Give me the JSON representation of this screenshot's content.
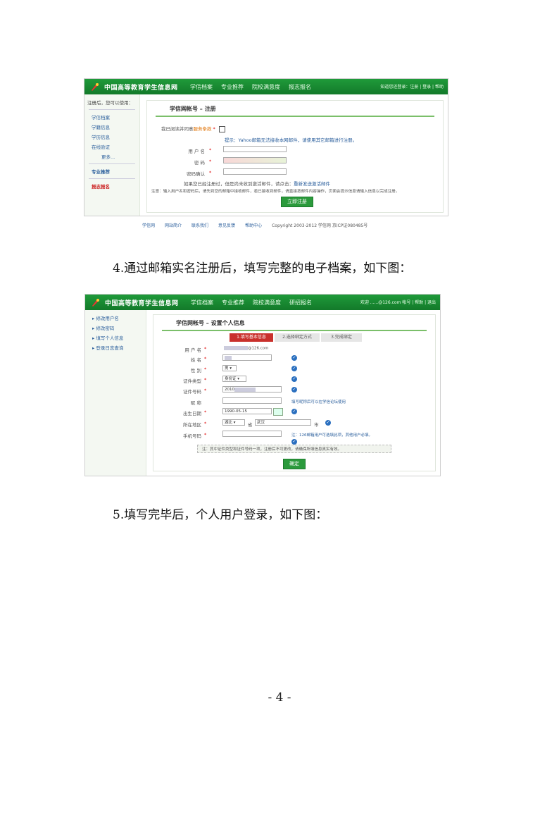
{
  "screenshot1": {
    "brand": "中国高等教育学生信息网",
    "nav": [
      "学信档案",
      "专业推荐",
      "院校满意度",
      "报志报名"
    ],
    "header_links": "知道您还登录：注册 | 登录 | 帮助",
    "side_header": "注册后，您可以使用：",
    "side_items": [
      "学信档案",
      "学籍信息",
      "学历信息",
      "在线验证",
      "更多..."
    ],
    "side_recommend": "专业推荐",
    "side_enroll": "报志报名",
    "panel_title": "学信网帐号 – 注册",
    "field_agree": "我已阅读并同意",
    "agree_link": "服务条款",
    "hint": "提示：Yahoo邮箱无法接收本网邮件，请使用其它邮箱进行注册。",
    "field_username": "用 户 名",
    "field_password": "密    码",
    "field_confirm": "密码确认",
    "note1": "如果您已经注册过，但是尚未收到激活邮件，请点击：",
    "note1_link": "重新发送激活邮件",
    "note2": "注意：输入用户名和密码后，请先到您的邮箱中接收邮件，若已接收到邮件，请直接按邮件内容操作，页面会提示信息请输入信息以完成注册。",
    "submit": "立即注册",
    "footer": [
      "学信网",
      "网站简介",
      "联系我们",
      "意见反馈",
      "帮助中心"
    ],
    "copyright": "Copyright 2003-2012 学信网 京ICP证080485号"
  },
  "caption4": "4.通过邮箱实名注册后，填写完整的电子档案，如下图：",
  "screenshot2": {
    "brand": "中国高等教育学生信息网",
    "nav": [
      "学信档案",
      "专业推荐",
      "院校满意度",
      "研招报名"
    ],
    "header_links": "欢迎 ......@126.com 帐号 | 帮助 | 退出",
    "side_items": [
      "修改用户名",
      "修改密码",
      "填写个人信息",
      "登录日志查询"
    ],
    "panel_title": "学信网帐号 – 设置个人信息",
    "steps": [
      "1.填写基本信息",
      "2.选择绑定方式",
      "3.完成绑定"
    ],
    "field_username": "用 户 名",
    "username_value": "@126.com",
    "field_name": "姓    名",
    "field_gender": "性    别",
    "gender_value": "男",
    "field_id_type": "证件类型",
    "id_type_value": "身份证",
    "field_id_no": "证件号码",
    "id_no_value": "2010",
    "field_nickname": "昵    称",
    "nickname_hint": "填写昵称后可以在学信论坛使用",
    "field_birth": "出生日期",
    "birth_value": "1990-05-15",
    "field_location": "所在地区",
    "province_value": "湖北",
    "city_label": "省",
    "city_value": "武汉",
    "city_suffix": "市",
    "field_phone": "手机号码",
    "phone_hint": "注：126邮箱用户可选填此项，其他用户必填。",
    "note": "注：其中证件类型和证件号码一项，注册后不可更改，请确保所填信息真实有效。",
    "submit": "确定"
  },
  "caption5": "5.填写完毕后，个人用户登录，如下图：",
  "page_number": "- 4 -"
}
